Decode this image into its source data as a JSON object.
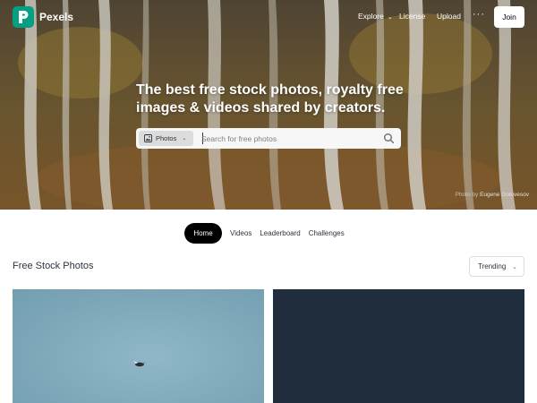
{
  "colors": {
    "brand_green": "#05a081",
    "active_tab_bg": "#000000",
    "photo_2_color": "#1f2d3c",
    "photo_1_color": "#82abbc"
  },
  "header": {
    "brand": "Pexels",
    "nav": {
      "explore": "Explore",
      "license": "License",
      "upload": "Upload",
      "more": "···"
    },
    "join_label": "Join",
    "icons": [
      "pexels-logo-icon",
      "chevron-down-icon",
      "more-dots-icon"
    ]
  },
  "hero": {
    "headline": "The best free stock photos, royalty free images & videos shared by creators.",
    "search": {
      "type_label": "Photos",
      "placeholder": "Search for free photos",
      "value": ""
    },
    "credit": {
      "prefix": "Photo by",
      "author": "Eugene Golovesov"
    }
  },
  "tabs": [
    {
      "label": "Home",
      "active": true
    },
    {
      "label": "Videos",
      "active": false
    },
    {
      "label": "Leaderboard",
      "active": false
    },
    {
      "label": "Challenges",
      "active": false
    }
  ],
  "section": {
    "title": "Free Stock Photos",
    "sort_label": "Trending"
  }
}
